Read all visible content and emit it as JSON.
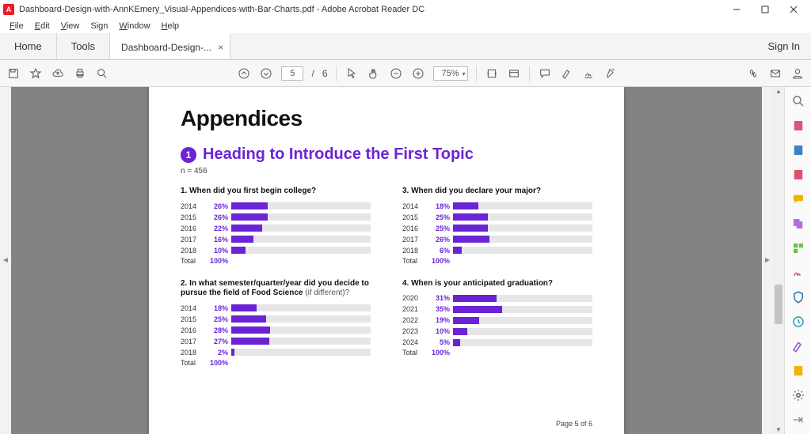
{
  "window": {
    "title": "Dashboard-Design-with-AnnKEmery_Visual-Appendices-with-Bar-Charts.pdf - Adobe Acrobat Reader DC"
  },
  "menu": {
    "file": "File",
    "edit": "Edit",
    "view": "View",
    "sign": "Sign",
    "window": "Window",
    "help": "Help"
  },
  "tabs": {
    "home": "Home",
    "tools": "Tools",
    "doc": "Dashboard-Design-...",
    "signin": "Sign In"
  },
  "toolbar": {
    "page_current": "5",
    "page_sep": "/",
    "page_total": "6",
    "zoom": "75%"
  },
  "page": {
    "title": "Appendices",
    "topic_number": "1",
    "topic_text": "Heading to Introduce the First Topic",
    "n_note": "n = 456",
    "footer": "Page 5 of 6"
  },
  "chart_labels": {
    "total": "Total",
    "total_value": "100%"
  },
  "chart_data": [
    {
      "id": "q1",
      "type": "bar",
      "title": "1. When did you first begin college?",
      "categories": [
        "2014",
        "2015",
        "2016",
        "2017",
        "2018"
      ],
      "values": [
        26,
        26,
        22,
        16,
        10
      ]
    },
    {
      "id": "q3",
      "type": "bar",
      "title": "3. When did you declare your major?",
      "categories": [
        "2014",
        "2015",
        "2016",
        "2017",
        "2018"
      ],
      "values": [
        18,
        25,
        25,
        26,
        6
      ]
    },
    {
      "id": "q2",
      "type": "bar",
      "title": "2. In what semester/quarter/year did you decide to pursue the field of Food Science",
      "title_suffix": " (if different)?",
      "categories": [
        "2014",
        "2015",
        "2016",
        "2017",
        "2018"
      ],
      "values": [
        18,
        25,
        28,
        27,
        2
      ]
    },
    {
      "id": "q4",
      "type": "bar",
      "title": "4. When is your anticipated graduation?",
      "categories": [
        "2020",
        "2021",
        "2022",
        "2023",
        "2024"
      ],
      "values": [
        31,
        35,
        19,
        10,
        5
      ]
    }
  ],
  "colors": {
    "accent": "#6a24d6",
    "bar_bg": "#e6e6e6"
  }
}
